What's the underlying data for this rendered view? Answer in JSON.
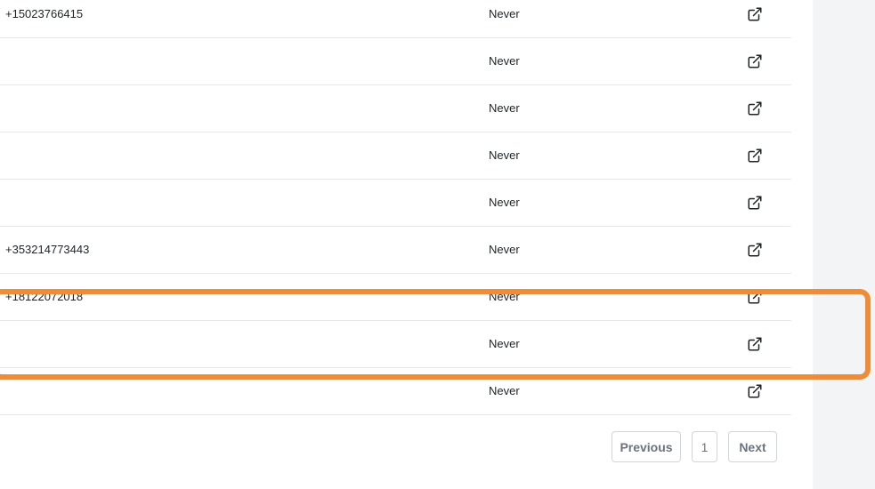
{
  "table": {
    "rows": [
      {
        "phone": "+15023766415",
        "last": "Never"
      },
      {
        "phone": "",
        "last": "Never"
      },
      {
        "phone": "",
        "last": "Never"
      },
      {
        "phone": "",
        "last": "Never"
      },
      {
        "phone": "",
        "last": "Never"
      },
      {
        "phone": "+353214773443",
        "last": "Never"
      },
      {
        "phone": "+18122072018",
        "last": "Never"
      },
      {
        "phone": "",
        "last": "Never"
      },
      {
        "phone": "",
        "last": "Never"
      }
    ],
    "action_icon": "external-link-icon"
  },
  "pagination": {
    "previous_label": "Previous",
    "page_label": "1",
    "next_label": "Next"
  },
  "colors": {
    "highlight": "#ee8c3a",
    "sidebar": "#f3f4f6",
    "divider": "#e5e7eb"
  }
}
